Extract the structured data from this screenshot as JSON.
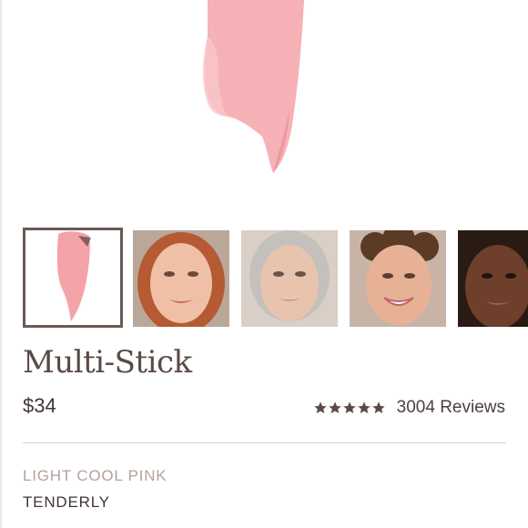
{
  "product": {
    "title": "Multi-Stick",
    "price": "$34",
    "rating": 5,
    "rating_max": 5,
    "reviews_label": "3004 Reviews"
  },
  "shade": {
    "family": "LIGHT COOL PINK",
    "name": "TENDERLY"
  },
  "colors": {
    "swatch": "#f4a3a9",
    "selected_border": "#6a5a54",
    "star": "#5a4a46",
    "divider": "#d8d3d1"
  },
  "thumbnails": [
    {
      "subject": "swatch",
      "selected": true
    },
    {
      "subject": "model-red-hair",
      "selected": false
    },
    {
      "subject": "model-gray-hair",
      "selected": false
    },
    {
      "subject": "model-curly-hair",
      "selected": false
    },
    {
      "subject": "model-dark-skin",
      "selected": false
    }
  ]
}
